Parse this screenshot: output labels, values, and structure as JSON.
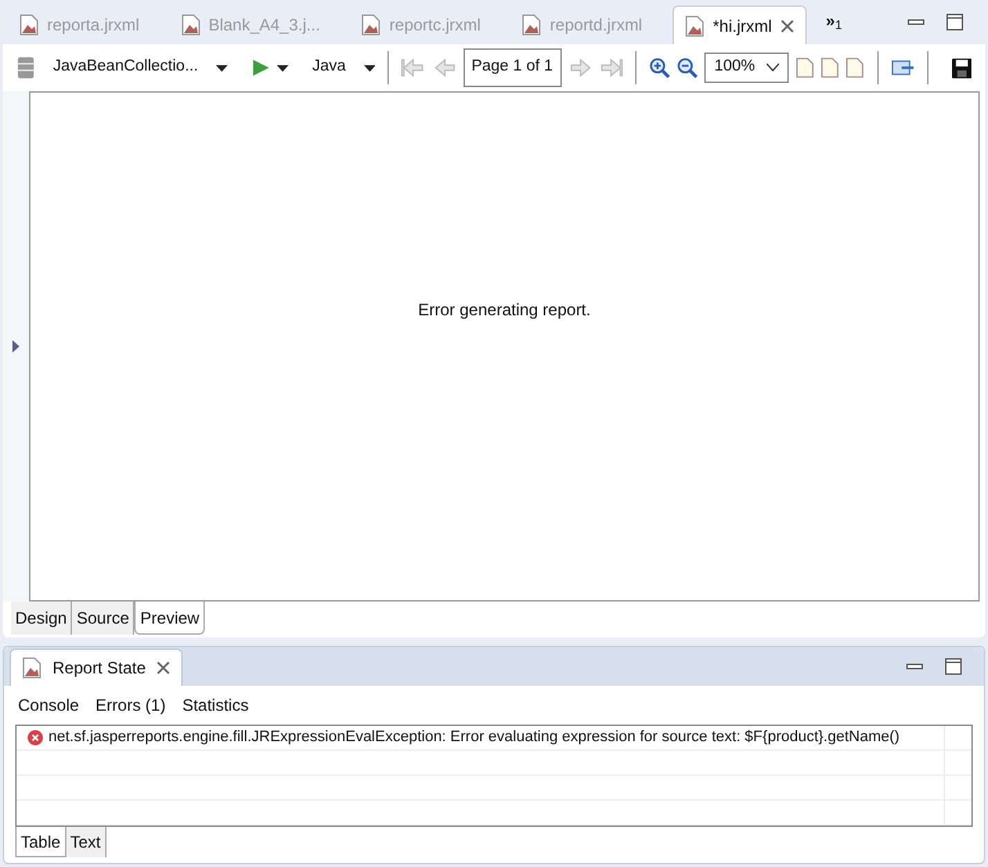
{
  "editor_tabs": [
    {
      "label": "reporta.jrxml",
      "selected": false
    },
    {
      "label": "Blank_A4_3.j...",
      "selected": false
    },
    {
      "label": "reportc.jrxml",
      "selected": false
    },
    {
      "label": "reportd.jrxml",
      "selected": false
    },
    {
      "label": "*hi.jrxml",
      "selected": true
    }
  ],
  "overflow": {
    "symbol": "»",
    "count": "1"
  },
  "toolbar": {
    "data_adapter": "JavaBeanCollectio...",
    "language": "Java",
    "page": "Page 1 of 1",
    "zoom": "100%"
  },
  "preview_message": "Error generating report.",
  "view_tabs": [
    {
      "label": "Design",
      "selected": false
    },
    {
      "label": "Source",
      "selected": false
    },
    {
      "label": "Preview",
      "selected": true
    }
  ],
  "report_state": {
    "title": "Report State",
    "tabs": [
      {
        "label": "Console",
        "selected": false
      },
      {
        "label": "Errors (1)",
        "selected": false
      },
      {
        "label": "Statistics",
        "selected": false
      }
    ],
    "errors": [
      "net.sf.jasperreports.engine.fill.JRExpressionEvalException: Error evaluating expression for source text: $F{product}.getName()"
    ],
    "bottom_tabs": [
      {
        "label": "Table",
        "selected": true
      },
      {
        "label": "Text",
        "selected": false
      }
    ]
  }
}
